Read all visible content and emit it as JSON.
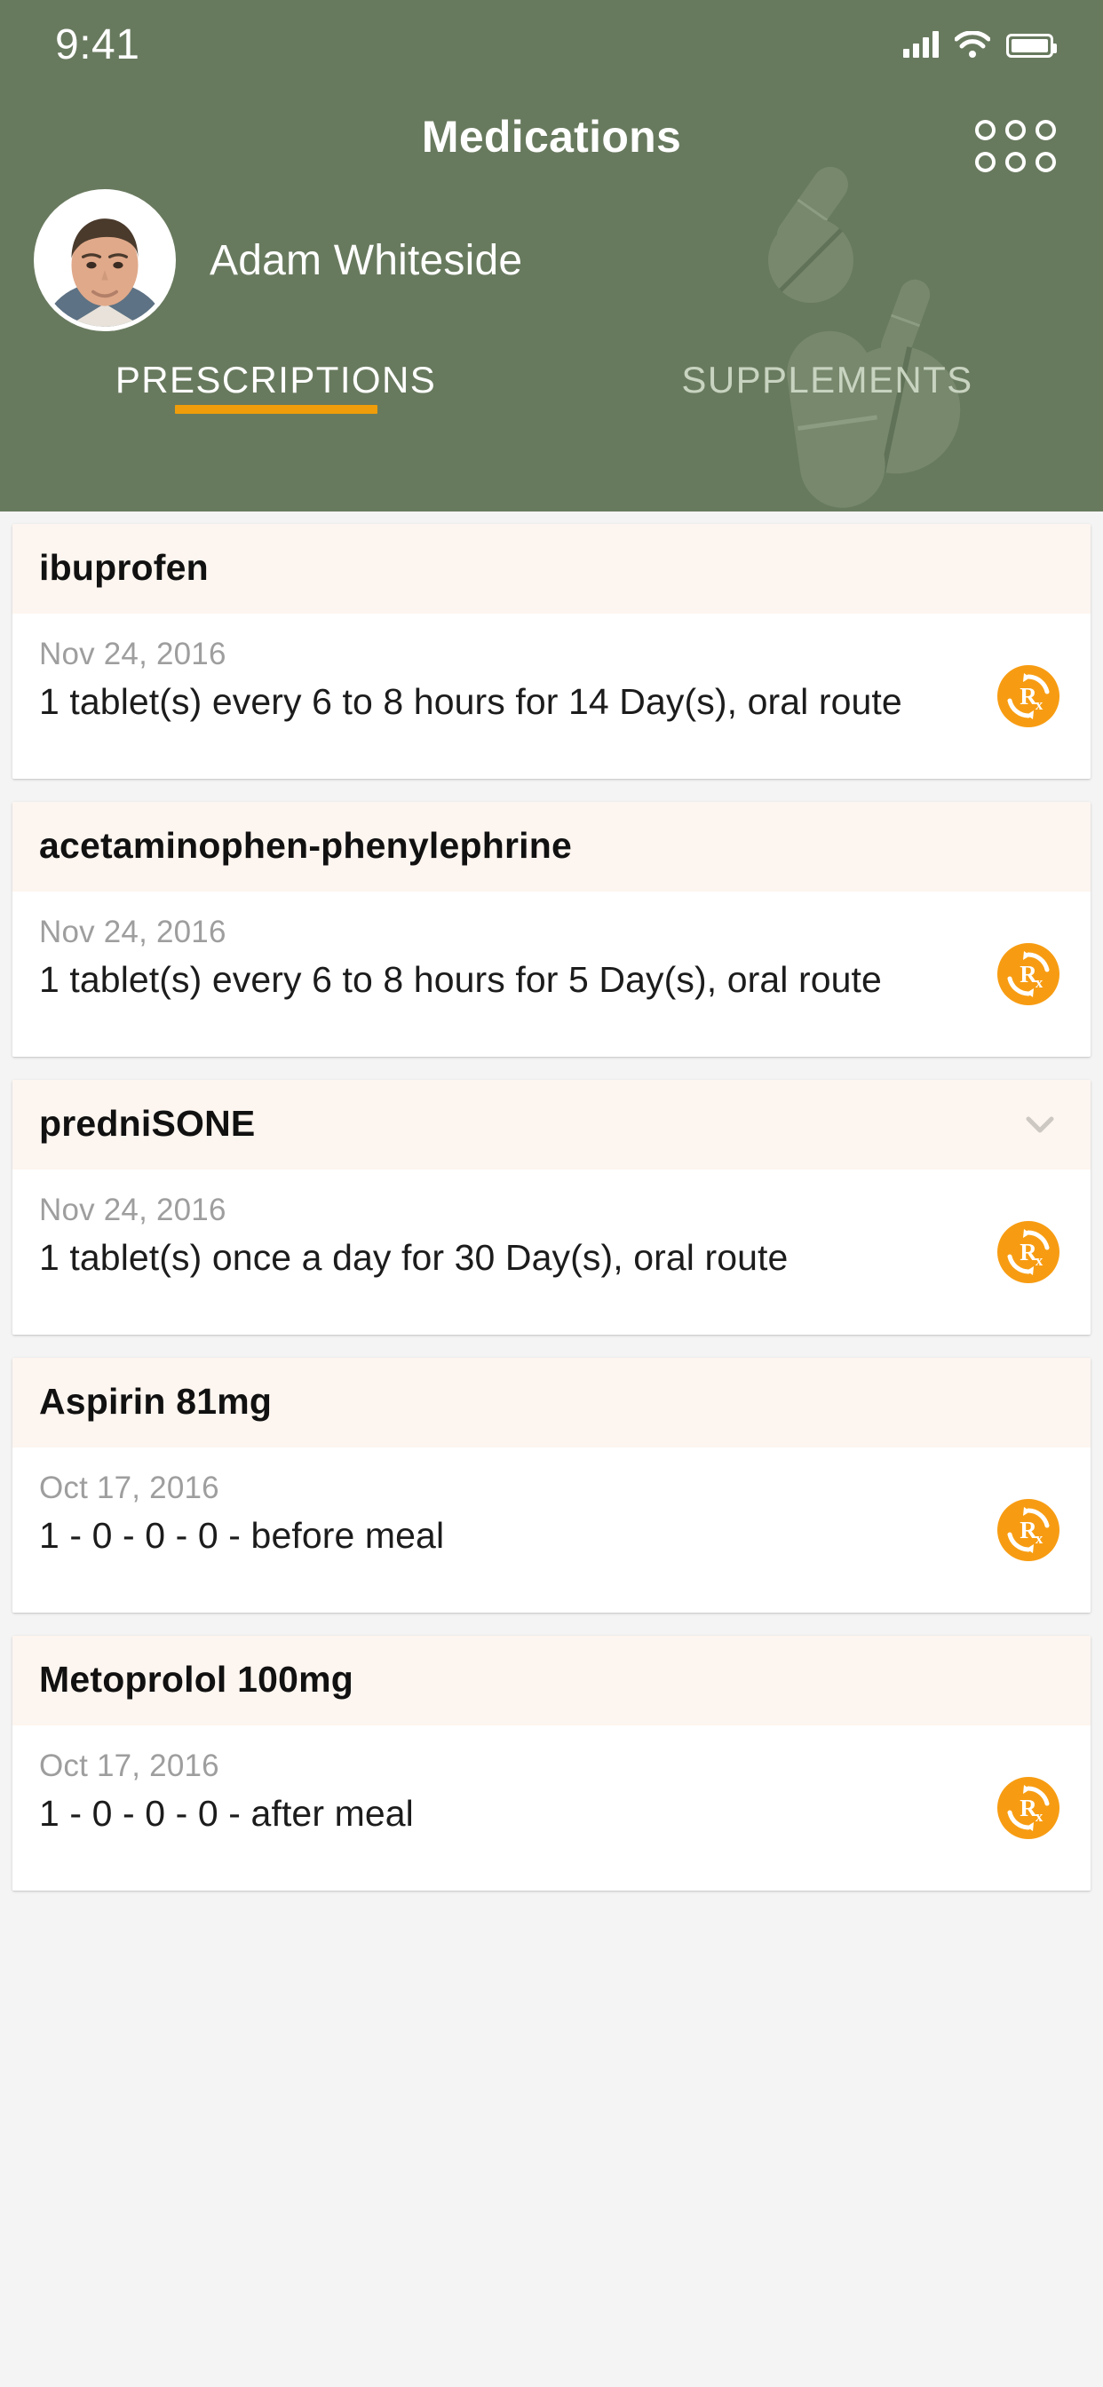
{
  "status_bar": {
    "time": "9:41",
    "signal_icon": "cellular-signal-icon",
    "wifi_icon": "wifi-icon",
    "battery_icon": "battery-full-icon"
  },
  "header": {
    "title": "Medications",
    "menu_icon": "grid-menu-icon",
    "background_color": "#687a5e",
    "accent_color": "#ef9d0a",
    "patient": {
      "name": "Adam Whiteside",
      "avatar_alt": "patient-avatar"
    }
  },
  "tabs": [
    {
      "label": "PRESCRIPTIONS",
      "active": true
    },
    {
      "label": "SUPPLEMENTS",
      "active": false
    }
  ],
  "medications": [
    {
      "name": "ibuprofen",
      "date": "Nov 24, 2016",
      "dose": "1 tablet(s) every 6 to 8 hours for 14 Day(s), oral route",
      "rx_icon": "rx-refill-icon",
      "has_chevron": false
    },
    {
      "name": "acetaminophen-phenylephrine",
      "date": "Nov 24, 2016",
      "dose": "1 tablet(s) every 6 to 8 hours for 5 Day(s), oral route",
      "rx_icon": "rx-refill-icon",
      "has_chevron": false
    },
    {
      "name": "predniSONE",
      "date": "Nov 24, 2016",
      "dose": "1 tablet(s) once a day for 30 Day(s), oral route",
      "rx_icon": "rx-refill-icon",
      "has_chevron": true,
      "chevron_icon": "chevron-down-icon"
    },
    {
      "name": "Aspirin 81mg",
      "date": "Oct 17, 2016",
      "dose": "1 - 0 - 0 - 0 - before meal",
      "rx_icon": "rx-refill-icon",
      "has_chevron": false
    },
    {
      "name": "Metoprolol 100mg",
      "date": "Oct 17, 2016",
      "dose": "1 - 0 - 0 - 0 - after meal",
      "rx_icon": "rx-refill-icon",
      "has_chevron": false
    }
  ]
}
